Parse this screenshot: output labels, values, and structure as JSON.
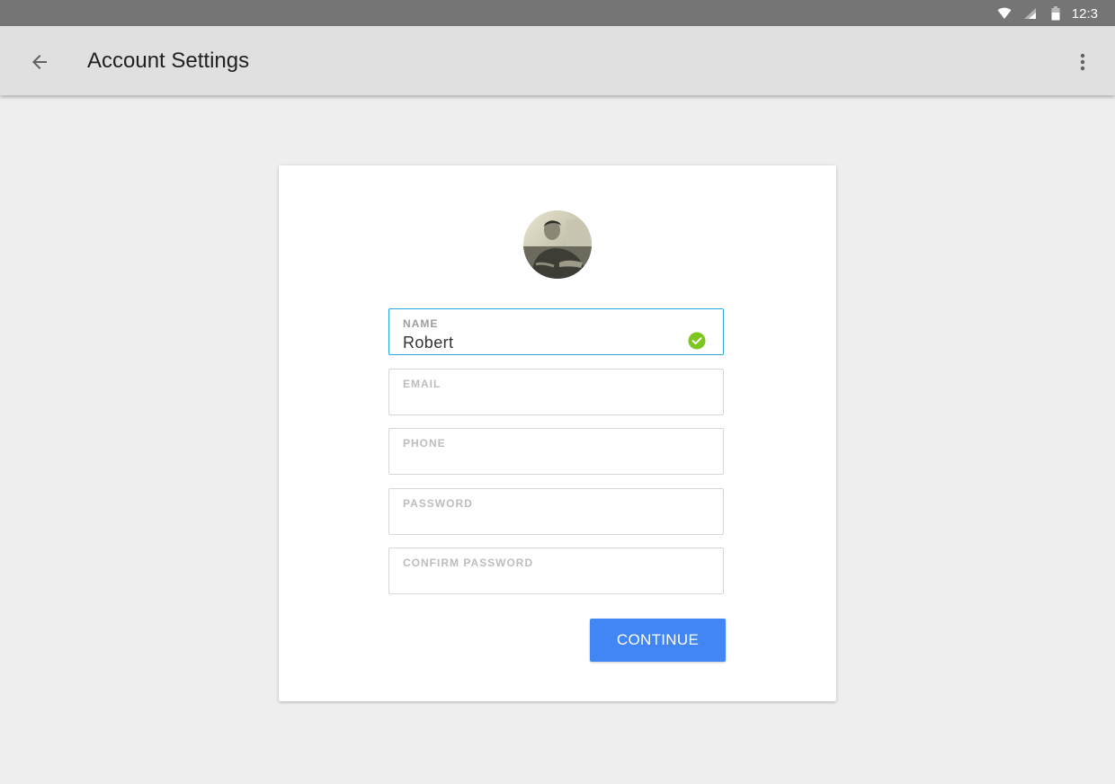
{
  "status_bar": {
    "time": "12:3",
    "icons": [
      "wifi-icon",
      "cell-signal-icon",
      "battery-icon"
    ]
  },
  "app_bar": {
    "title": "Account Settings",
    "back_icon": "arrow-back-icon",
    "menu_icon": "more-vert-icon"
  },
  "form": {
    "avatar": "profile-photo",
    "fields": [
      {
        "label": "NAME",
        "value": "Robert",
        "state": "valid",
        "icon": "check-circle-icon"
      },
      {
        "label": "EMAIL",
        "value": ""
      },
      {
        "label": "PHONE",
        "value": ""
      },
      {
        "label": "PASSWORD",
        "value": ""
      },
      {
        "label": "CONFIRM PASSWORD",
        "value": ""
      }
    ],
    "submit_label": "CONTINUE"
  },
  "colors": {
    "status_bar": "#757575",
    "app_bar": "#e0e0e0",
    "background": "#eeeeee",
    "active_border": "#29a8e0",
    "valid_check": "#7cc61f",
    "button": "#4285f4"
  }
}
